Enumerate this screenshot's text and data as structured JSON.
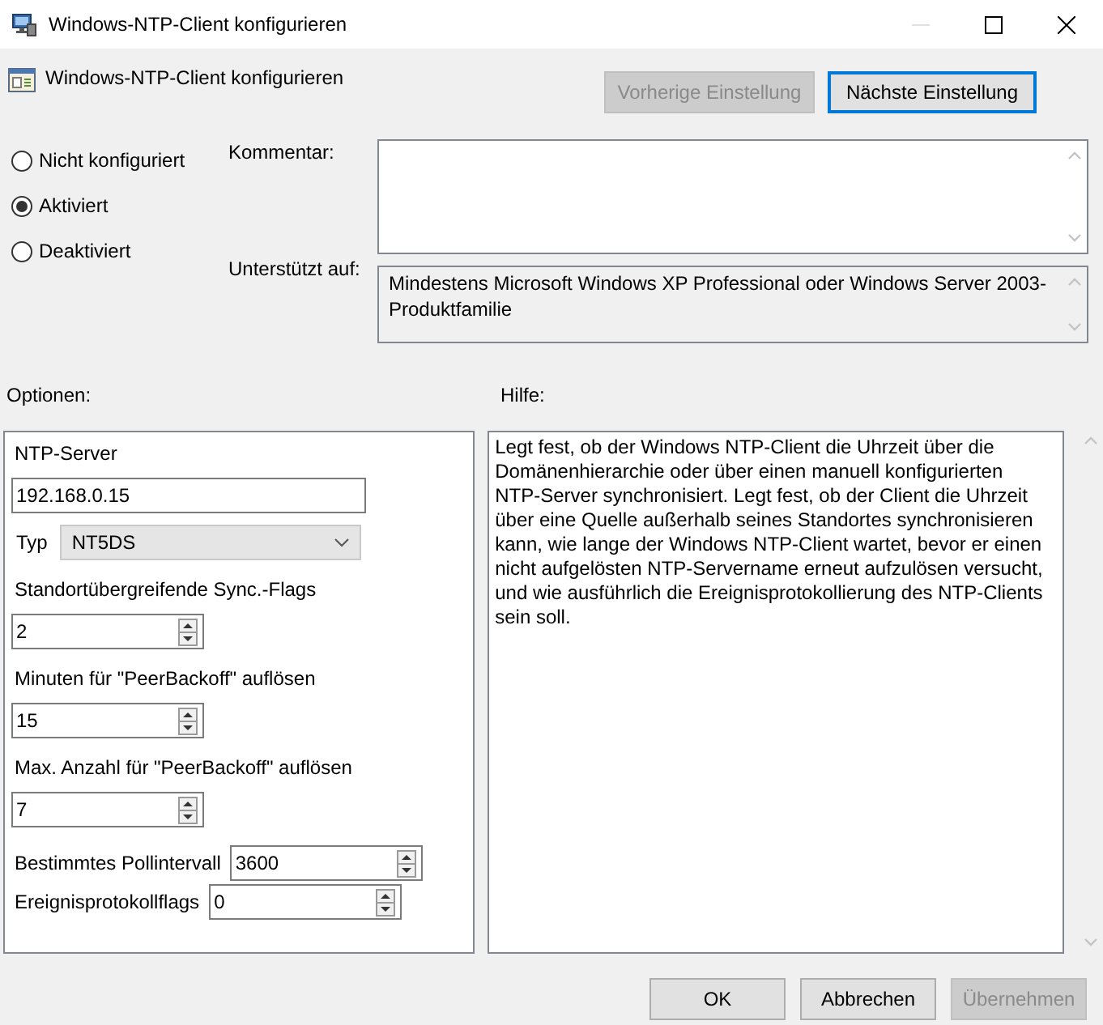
{
  "window": {
    "title": "Windows-NTP-Client konfigurieren"
  },
  "policy": {
    "title": "Windows-NTP-Client konfigurieren"
  },
  "nav_buttons": [
    {
      "label": "Vorherige Einstellung",
      "disabled": true,
      "focused": false
    },
    {
      "label": "Nächste Einstellung",
      "disabled": false,
      "focused": true
    }
  ],
  "state_options": [
    {
      "label": "Nicht konfiguriert",
      "selected": false
    },
    {
      "label": "Aktiviert",
      "selected": true
    },
    {
      "label": "Deaktiviert",
      "selected": false
    }
  ],
  "comment": {
    "label": "Kommentar:"
  },
  "supported_on": {
    "label": "Unterstützt auf:",
    "value": "Mindestens Microsoft Windows XP Professional oder Windows Server 2003-Produktfamilie"
  },
  "options": {
    "label": "Optionen:",
    "fields": [
      {
        "kind": "text",
        "label": "NTP-Server",
        "value": "192.168.0.15"
      },
      {
        "kind": "select",
        "label": "Typ",
        "value": "NT5DS"
      },
      {
        "kind": "spin",
        "label": "Standortübergreifende Sync.-Flags",
        "value": "2"
      },
      {
        "kind": "spin",
        "label": "Minuten für \"PeerBackoff\" auflösen",
        "value": "15"
      },
      {
        "kind": "spin",
        "label": "Max. Anzahl für \"PeerBackoff\" auflösen",
        "value": "7"
      },
      {
        "kind": "inline-spin",
        "label": "Bestimmtes Pollintervall",
        "value": "3600"
      },
      {
        "kind": "inline-spin",
        "label": "Ereignisprotokollflags",
        "value": "0"
      }
    ]
  },
  "help": {
    "label": "Hilfe:",
    "text": "Legt fest, ob der Windows NTP-Client die Uhrzeit über die Domänenhierarchie oder über einen manuell konfigurierten NTP-Server synchronisiert. Legt fest, ob der Client die Uhrzeit über eine Quelle außerhalb seines Standortes synchronisieren kann, wie lange der Windows NTP-Client wartet, bevor er einen nicht aufgelösten NTP-Servername erneut aufzulösen versucht, und wie ausführlich die Ereignisprotokollierung des NTP-Clients sein soll."
  },
  "buttons": [
    {
      "label": "OK",
      "disabled": false
    },
    {
      "label": "Abbrechen",
      "disabled": false
    },
    {
      "label": "Übernehmen",
      "disabled": true
    }
  ]
}
